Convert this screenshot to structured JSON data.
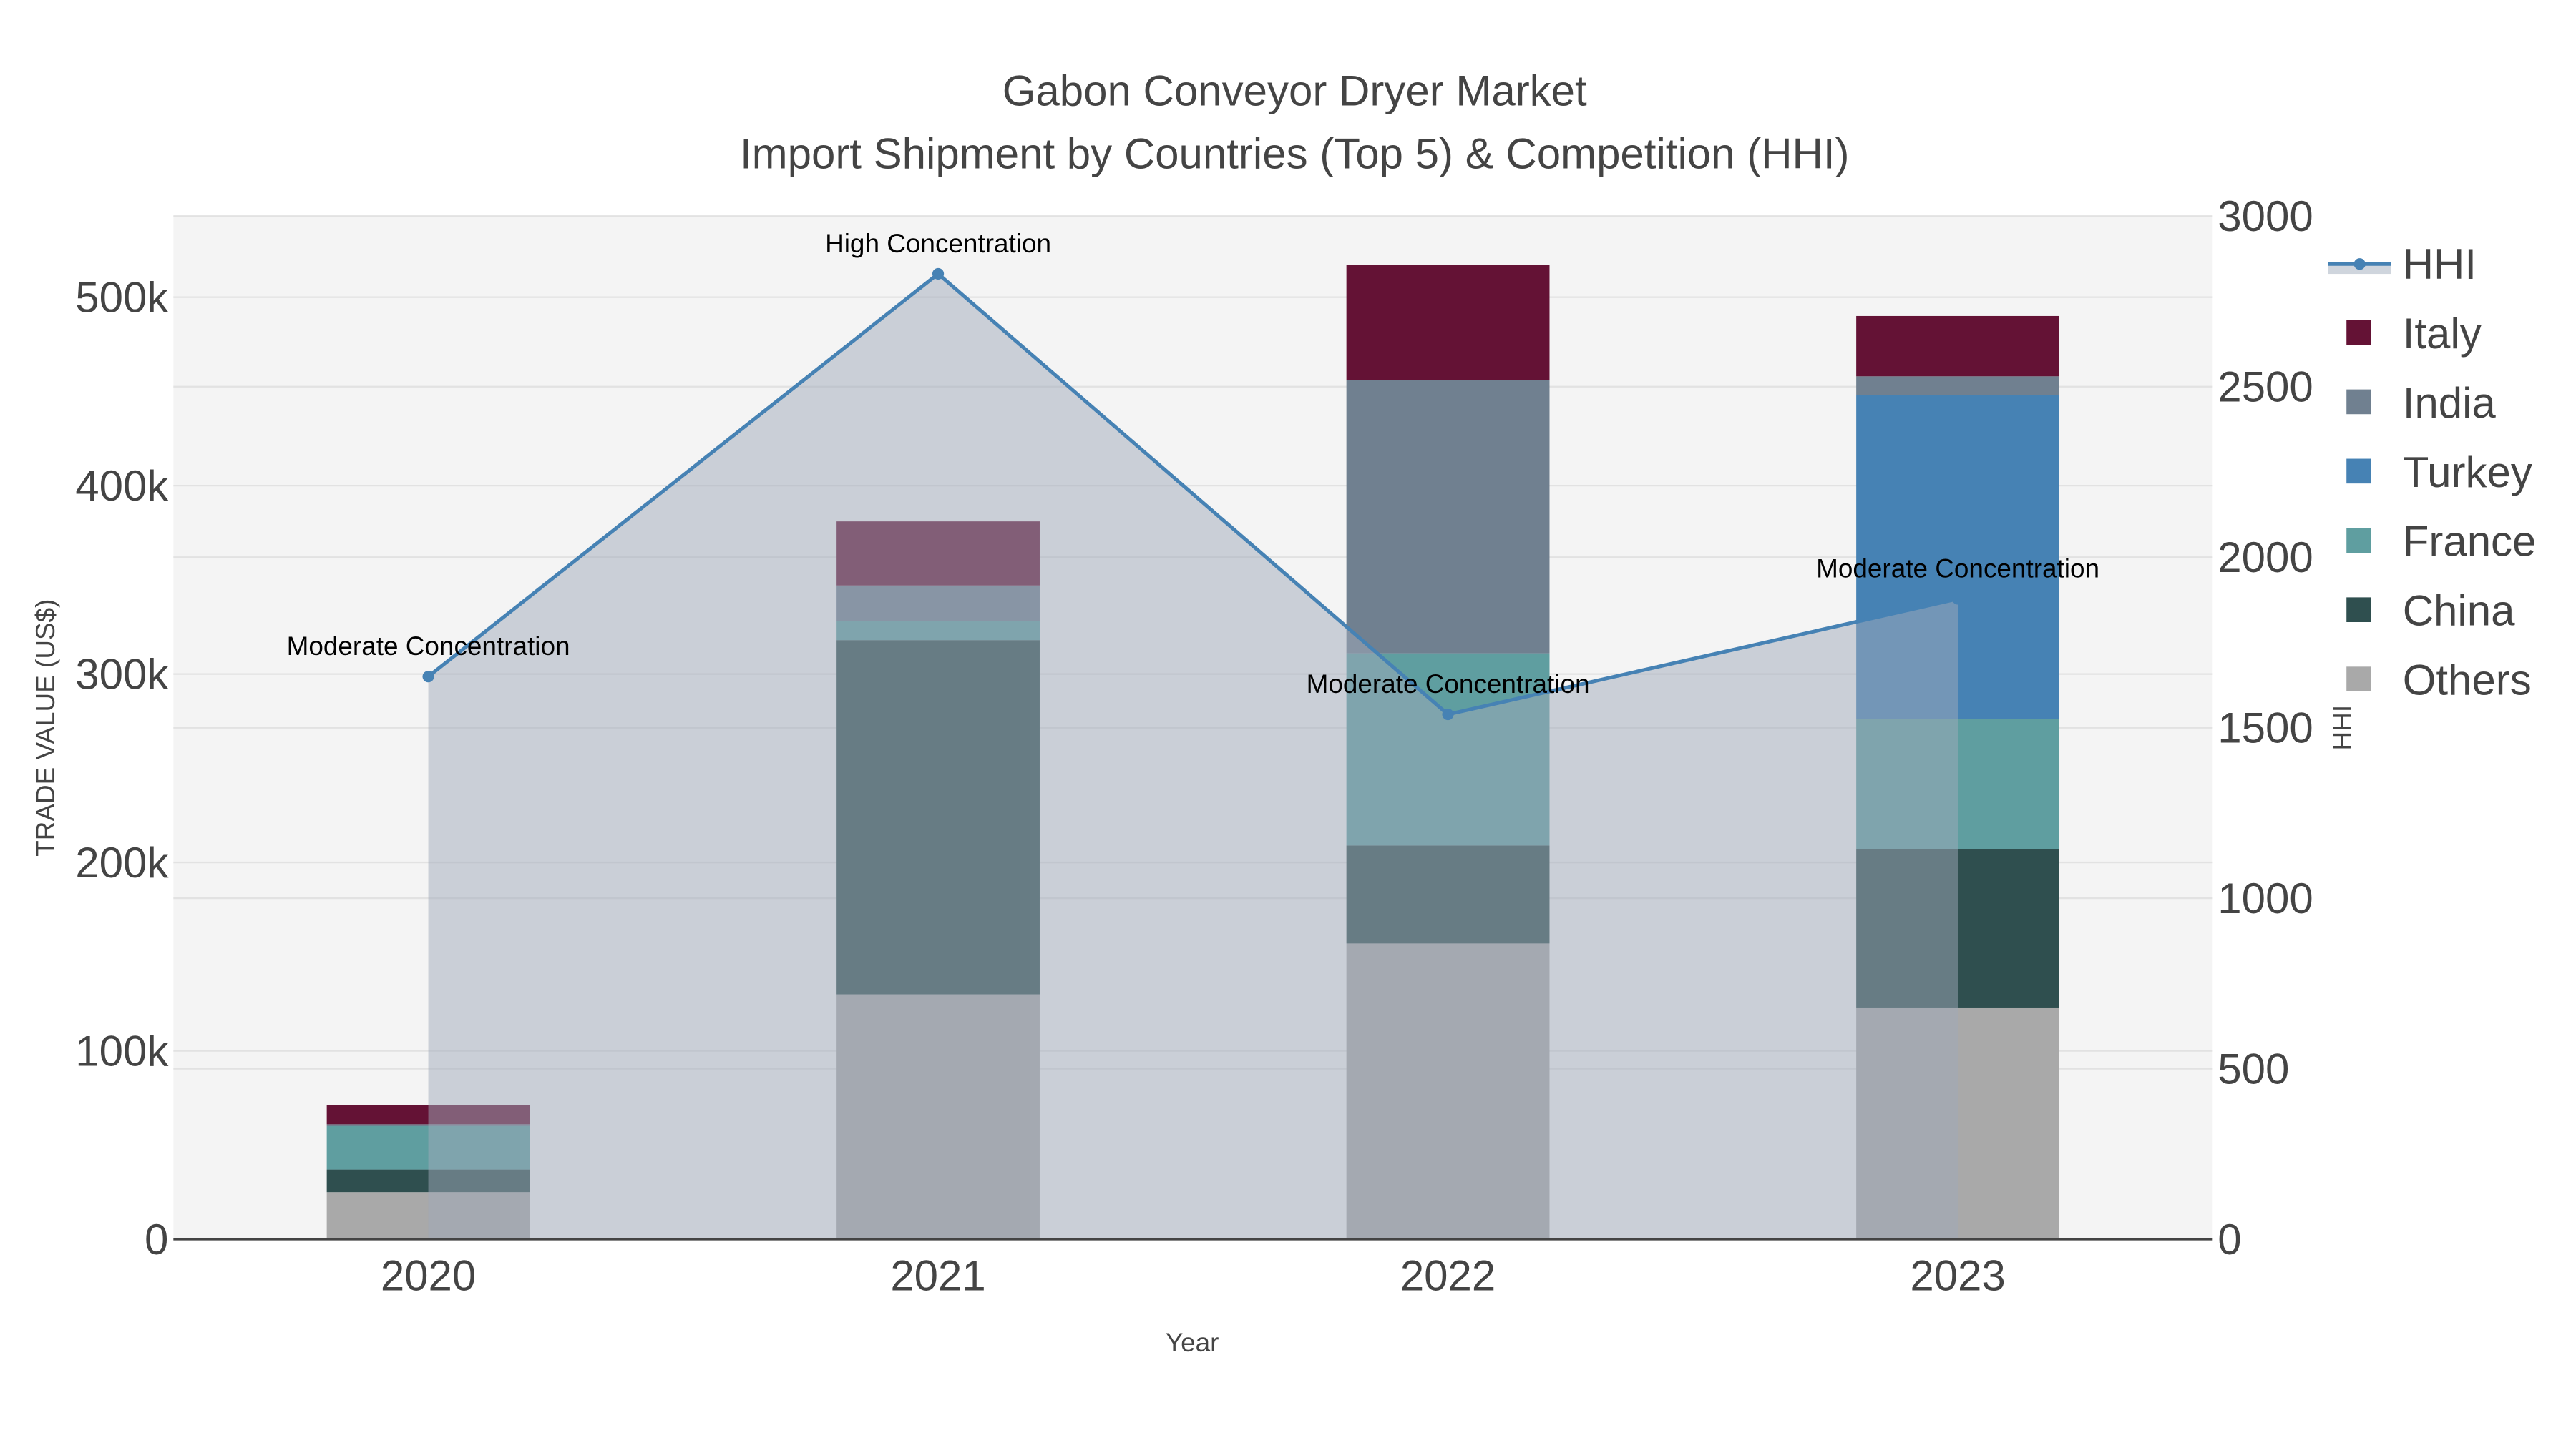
{
  "chart_data": {
    "type": "bar",
    "barmode": "stack",
    "title": "Gabon Conveyor Dryer Market",
    "subtitle": "Import Shipment by Countries (Top 5) & Competition (HHI)",
    "xlabel": "Year",
    "ylabel": "TRADE VALUE (US$)",
    "y2label": "HHI",
    "categories": [
      "2020",
      "2021",
      "2022",
      "2023"
    ],
    "ylim": [
      0,
      543000
    ],
    "y2lim": [
      0,
      3000
    ],
    "yticks": [
      0,
      100000,
      200000,
      300000,
      400000,
      500000
    ],
    "ytick_labels": [
      "0",
      "100k",
      "200k",
      "300k",
      "400k",
      "500k"
    ],
    "y2ticks": [
      0,
      500,
      1000,
      1500,
      2000,
      2500,
      3000
    ],
    "y2tick_labels": [
      "0",
      "500",
      "1000",
      "1500",
      "2000",
      "2500",
      "3000"
    ],
    "grid": true,
    "legend_position": "right",
    "series": [
      {
        "name": "Others",
        "color": "#a9a9a9",
        "values": [
          25000,
          130000,
          157000,
          123000
        ]
      },
      {
        "name": "China",
        "color": "#2f4f4f",
        "values": [
          12000,
          188000,
          52000,
          84000
        ]
      },
      {
        "name": "France",
        "color": "#5f9ea0",
        "values": [
          23000,
          10000,
          102000,
          69000
        ]
      },
      {
        "name": "Turkey",
        "color": "#4682b4",
        "values": [
          0,
          0,
          0,
          172000
        ]
      },
      {
        "name": "India",
        "color": "#708090",
        "values": [
          1000,
          19000,
          145000,
          10000
        ]
      },
      {
        "name": "Italy",
        "color": "#641235",
        "values": [
          10000,
          34000,
          61000,
          32000
        ]
      }
    ],
    "line": {
      "name": "HHI",
      "color": "#4682b4",
      "axis": "y2",
      "values": [
        1650,
        2831,
        1539,
        1878
      ],
      "annotations": [
        "Moderate Concentration",
        "High Concentration",
        "Moderate Concentration",
        "Moderate Concentration"
      ]
    },
    "legend_order": [
      "HHI",
      "Italy",
      "India",
      "Turkey",
      "France",
      "China",
      "Others"
    ]
  }
}
